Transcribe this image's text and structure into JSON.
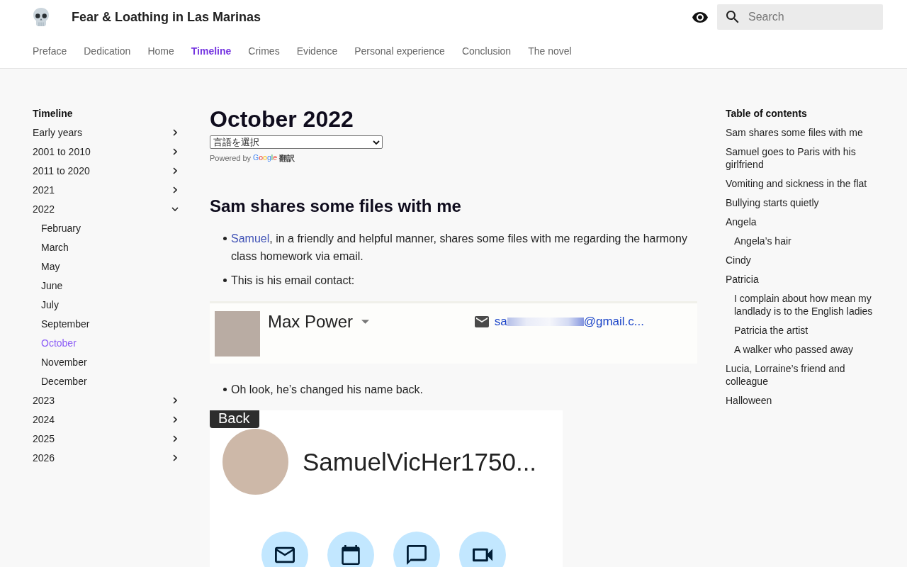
{
  "site": {
    "title": "Fear & Loathing in Las Marinas"
  },
  "search": {
    "placeholder": "Search"
  },
  "nav": [
    {
      "label": "Preface",
      "selected": false
    },
    {
      "label": "Dedication",
      "selected": false
    },
    {
      "label": "Home",
      "selected": false
    },
    {
      "label": "Timeline",
      "selected": true
    },
    {
      "label": "Crimes",
      "selected": false
    },
    {
      "label": "Evidence",
      "selected": false
    },
    {
      "label": "Personal experience",
      "selected": false
    },
    {
      "label": "Conclusion",
      "selected": false
    },
    {
      "label": "The novel",
      "selected": false
    }
  ],
  "sidebar": {
    "title": "Timeline",
    "items": [
      {
        "label": "Early years",
        "expanded": false,
        "selected": false
      },
      {
        "label": "2001 to 2010",
        "expanded": false,
        "selected": false
      },
      {
        "label": "2011 to 2020",
        "expanded": false,
        "selected": false
      },
      {
        "label": "2021",
        "expanded": false,
        "selected": false
      },
      {
        "label": "2022",
        "expanded": true,
        "selected": false,
        "children": [
          {
            "label": "February",
            "selected": false
          },
          {
            "label": "March",
            "selected": false
          },
          {
            "label": "May",
            "selected": false
          },
          {
            "label": "June",
            "selected": false
          },
          {
            "label": "July",
            "selected": false
          },
          {
            "label": "September",
            "selected": false
          },
          {
            "label": "October",
            "selected": true
          },
          {
            "label": "November",
            "selected": false
          },
          {
            "label": "December",
            "selected": false
          }
        ]
      },
      {
        "label": "2023",
        "expanded": false,
        "selected": false
      },
      {
        "label": "2024",
        "expanded": false,
        "selected": false
      },
      {
        "label": "2025",
        "expanded": false,
        "selected": false
      },
      {
        "label": "2026",
        "expanded": false,
        "selected": false
      }
    ]
  },
  "article": {
    "title": "October 2022",
    "translate": {
      "select": "言語を選択",
      "powered_by": "Powered by",
      "brand": "Google",
      "service": "翻訳"
    },
    "blocks": [
      {
        "kind": "heading",
        "text": "Sam shares some files with me"
      },
      {
        "kind": "bullet",
        "link": "Samuel",
        "text": ", in a friendly and helpful manner, shares some files with me regarding the harmony class homework via email."
      },
      {
        "kind": "bullet",
        "text": "This is his email contact:"
      },
      {
        "kind": "contact_card",
        "name": "Max Power",
        "email_start": "sa",
        "email_end": "@gmail.c..."
      },
      {
        "kind": "bullet",
        "text": "Oh look, he’s changed his name back."
      },
      {
        "kind": "profile_card",
        "back": "Back",
        "name": "SamuelVicHer1750..."
      }
    ]
  },
  "toc": {
    "title": "Table of contents",
    "items": [
      {
        "label": "Sam shares some files with me"
      },
      {
        "label": "Samuel goes to Paris with his girlfriend"
      },
      {
        "label": "Vomiting and sickness in the flat"
      },
      {
        "label": "Bullying starts quietly"
      },
      {
        "label": "Angela",
        "children": [
          {
            "label": "Angela’s hair"
          }
        ]
      },
      {
        "label": "Cindy"
      },
      {
        "label": "Patricia",
        "children": [
          {
            "label": "I complain about how mean my landlady is to the English ladies"
          },
          {
            "label": "Patricia the artist"
          },
          {
            "label": "A walker who passed away"
          }
        ]
      },
      {
        "label": "Lucia, Lorraine’s friend and colleague"
      },
      {
        "label": "Halloween"
      }
    ]
  }
}
